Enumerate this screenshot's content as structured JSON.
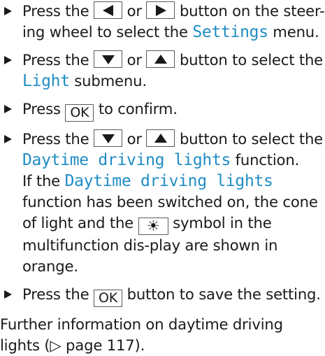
{
  "colors": {
    "text": "#1a1a1a",
    "highlight": "#1f8cc4"
  },
  "steps": [
    {
      "t1": "Press the",
      "k1": "left-arrow",
      "t2": "or",
      "k2": "right-arrow",
      "t3": "button on the steer-ing wheel to select the",
      "term": "Settings",
      "t4": "menu."
    },
    {
      "t1": "Press the",
      "k1": "down-arrow",
      "t2": "or",
      "k2": "up-arrow",
      "t3": "button to select the",
      "term": "Light",
      "t4": "submenu."
    },
    {
      "t1": "Press",
      "key": "OK",
      "t2": "to confirm."
    },
    {
      "t1": "Press the",
      "k1": "down-arrow",
      "t2": "or",
      "k2": "up-arrow",
      "t3": "button to select the",
      "term": "Daytime driving lights",
      "t4": "function.",
      "n1": "If the",
      "nterm": "Daytime driving lights",
      "n2": "function has been switched on, the cone of light and the",
      "symbol": "☀",
      "symbol_icon": "daytime-lights-icon",
      "n3": "symbol in the multifunction dis-play are shown in orange."
    },
    {
      "t1": "Press the",
      "key": "OK",
      "t2": "button to save the setting."
    }
  ],
  "note": {
    "text": "Further information on daytime driving lights",
    "ref": "(▷ page 117)."
  }
}
